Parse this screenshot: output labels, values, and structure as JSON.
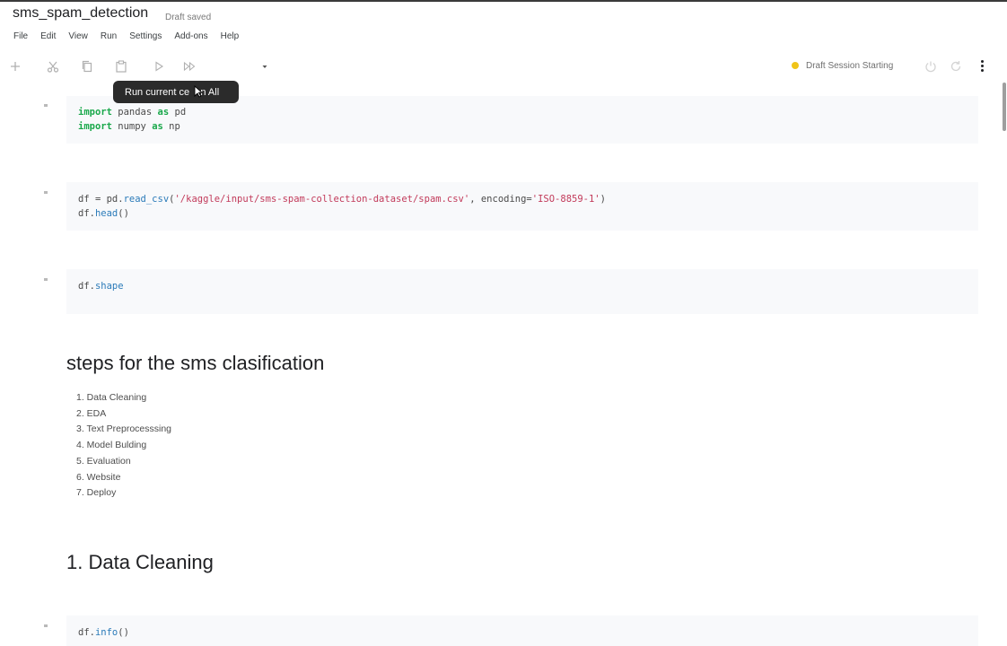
{
  "notebook": {
    "title": "sms_spam_detection",
    "save_status": "Draft saved"
  },
  "menu": [
    "File",
    "Edit",
    "View",
    "Run",
    "Settings",
    "Add-ons",
    "Help"
  ],
  "toolbar": {
    "icons": [
      "plus-icon",
      "scissors-icon",
      "copy-icon",
      "paste-icon",
      "run-cell-icon",
      "run-all-icon",
      "dropdown-caret-icon",
      "power-icon",
      "restart-icon",
      "more-vert-icon"
    ],
    "session_status": "Draft Session Starting",
    "status_color": "#f0c419"
  },
  "tooltip": {
    "text": "Run current ce    n All"
  },
  "cells": {
    "c1": {
      "line1": {
        "kw1": "import",
        "t1": " pandas ",
        "kw2": "as",
        "t2": " pd"
      },
      "line2": {
        "kw1": "import",
        "t1": " numpy ",
        "kw2": "as",
        "t2": " np"
      }
    },
    "c2": {
      "line1": {
        "a": "df = pd.",
        "fn": "read_csv",
        "b": "(",
        "s1": "'/kaggle/input/sms-spam-collection-dataset/spam.csv'",
        "c": ", encoding=",
        "s2": "'ISO-8859-1'",
        "d": ")"
      },
      "line2": {
        "a": "df.",
        "fn": "head",
        "b": "()"
      }
    },
    "c3": {
      "a": "df.",
      "fn": "shape"
    },
    "c4": {
      "a": "df.",
      "fn": "info",
      "b": "()"
    }
  },
  "markdown": {
    "heading1": "steps for the sms clasification",
    "steps": [
      "1. Data Cleaning",
      "2. EDA",
      "3. Text Preprocesssing",
      "4. Model Bulding",
      "5. Evaluation",
      "6. Website",
      "7. Deploy"
    ],
    "heading2": "1. Data Cleaning"
  }
}
